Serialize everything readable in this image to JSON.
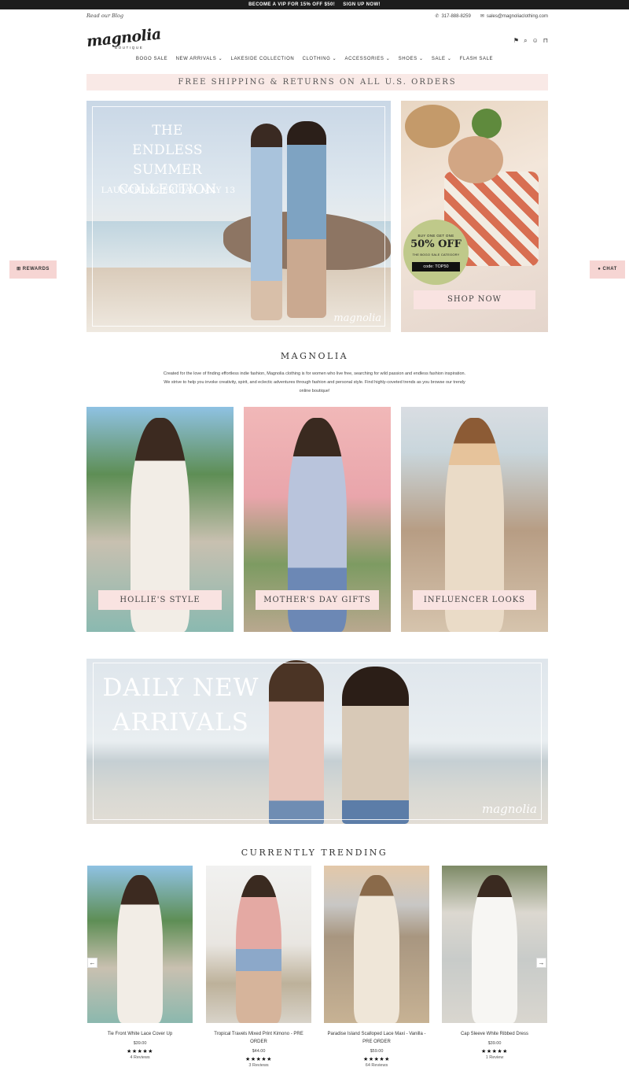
{
  "announcement": {
    "vip_text": "BECOME A VIP FOR 15% OFF $50!",
    "signup": "SIGN UP NOW!"
  },
  "utility": {
    "blog": "Read our Blog",
    "phone": "317-888-8259",
    "email": "sales@magnoliaclothing.com"
  },
  "logo": {
    "name": "magnolia",
    "sub": "BOUTIQUE"
  },
  "header_icons": {
    "flag": "flag-icon",
    "search": "search-icon",
    "account": "user-icon",
    "cart": "bag-icon"
  },
  "nav": [
    {
      "label": "BOGO SALE"
    },
    {
      "label": "NEW ARRIVALS ⌄"
    },
    {
      "label": "LAKESIDE COLLECTION"
    },
    {
      "label": "CLOTHING ⌄"
    },
    {
      "label": "ACCESSORIES ⌄"
    },
    {
      "label": "SHOES ⌄"
    },
    {
      "label": "SALE ⌄"
    },
    {
      "label": "FLASH SALE"
    }
  ],
  "shipping_banner": "FREE SHIPPING & RETURNS ON ALL U.S. ORDERS",
  "hero": {
    "title_lines": [
      "THE",
      "ENDLESS SUMMER",
      "COLLECTION"
    ],
    "launch": "LAUNCHING FRIDAY, MAY 13",
    "watermark": "magnolia"
  },
  "promo": {
    "bogo": "BUY ONE GET ONE",
    "off": "50% OFF",
    "category": "THE BOGO SALE CATEGORY",
    "code": "code: TOP50",
    "cta": "SHOP NOW"
  },
  "side_tabs": {
    "rewards": "REWARDS",
    "chat": "CHAT"
  },
  "about": {
    "title": "MAGNOLIA",
    "text": "Created for the love of finding effortless indie fashion, Magnolia clothing is for women who live free, searching for wild passion and endless fashion inspiration. We strive to help you invoke creativity, spirit, and eclectic adventures through fashion and personal style. Find highly-coveted trends as you browse our trendy online boutique!"
  },
  "tiles": [
    {
      "label": "HOLLIE'S STYLE"
    },
    {
      "label": "MOTHER'S DAY GIFTS"
    },
    {
      "label": "INFLUENCER LOOKS"
    }
  ],
  "arrivals": {
    "line1": "DAILY NEW",
    "line2": "ARRIVALS",
    "watermark": "magnolia"
  },
  "trending": {
    "title": "CURRENTLY TRENDING",
    "products": [
      {
        "name": "Tie Front White Lace Cover Up",
        "price": "$39.00",
        "stars": "★★★★★",
        "reviews": "4 Reviews"
      },
      {
        "name": "Tropical Travels Mixed Print Kimono - PRE ORDER",
        "price": "$44.00",
        "stars": "★★★★★",
        "reviews": "3 Reviews"
      },
      {
        "name": "Paradise Island Scalloped Lace Maxi - Vanilla - PRE ORDER",
        "price": "$59.00",
        "stars": "★★★★★",
        "reviews": "64 Reviews"
      },
      {
        "name": "Cap Sleeve White Ribbed Dress",
        "price": "$39.00",
        "stars": "★★★★★",
        "reviews": "1 Review"
      }
    ],
    "prev": "←",
    "next": "→"
  }
}
